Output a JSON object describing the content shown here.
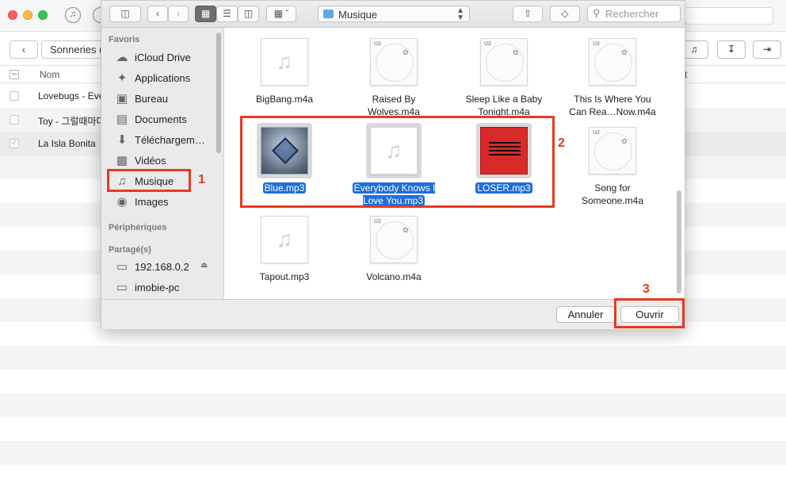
{
  "background_app": {
    "itunes_icon": "music-note-icon",
    "sonneries_label": "Sonneries (",
    "column_nom": "Nom",
    "column_right": "t",
    "rows": [
      {
        "title": "Lovebugs - Eve"
      },
      {
        "title": "Toy - 그럴때마다"
      },
      {
        "title": "La Isla Bonita"
      }
    ]
  },
  "dialog": {
    "toolbar": {
      "location": "Musique",
      "search_placeholder": "Rechercher"
    },
    "sidebar": {
      "favoris_heading": "Favoris",
      "favoris": [
        {
          "label": "iCloud Drive",
          "icon": "cloud-icon"
        },
        {
          "label": "Applications",
          "icon": "applications-icon"
        },
        {
          "label": "Bureau",
          "icon": "desktop-icon"
        },
        {
          "label": "Documents",
          "icon": "document-icon"
        },
        {
          "label": "Téléchargem…",
          "icon": "download-icon"
        },
        {
          "label": "Vidéos",
          "icon": "film-icon"
        },
        {
          "label": "Musique",
          "icon": "music-note-icon"
        },
        {
          "label": "Images",
          "icon": "camera-icon"
        }
      ],
      "peripheriques_heading": "Périphériques",
      "partages_heading": "Partagé(s)",
      "partages": [
        {
          "label": "192.168.0.2",
          "icon": "computer-icon"
        },
        {
          "label": "imobie-pc",
          "icon": "computer-icon"
        }
      ]
    },
    "files": [
      {
        "name": "BigBang.m4a",
        "art": "note",
        "selected": false
      },
      {
        "name": "Raised By Wolves.m4a",
        "art": "disc",
        "selected": false
      },
      {
        "name": "Sleep Like a Baby Tonight.m4a",
        "art": "disc",
        "selected": false
      },
      {
        "name": "This Is Where You Can Rea…Now.m4a",
        "art": "disc",
        "selected": false
      },
      {
        "name": "Blue.mp3",
        "art": "blue",
        "selected": true
      },
      {
        "name": "Everybody Knows I Love You.mp3",
        "art": "note",
        "selected": true
      },
      {
        "name": "LOSER.mp3",
        "art": "red",
        "selected": true
      },
      {
        "name": "Song for Someone.m4a",
        "art": "disc",
        "selected": false
      },
      {
        "name": "Tapout.mp3",
        "art": "note",
        "selected": false
      },
      {
        "name": "Volcano.m4a",
        "art": "disc",
        "selected": false
      }
    ],
    "footer": {
      "cancel_label": "Annuler",
      "open_label": "Ouvrir"
    }
  },
  "annotations": {
    "step1": "1",
    "step2": "2",
    "step3": "3",
    "color": "#e8391f"
  },
  "colors": {
    "selection": "#1e6ee0",
    "folder": "#5fa8e8"
  }
}
